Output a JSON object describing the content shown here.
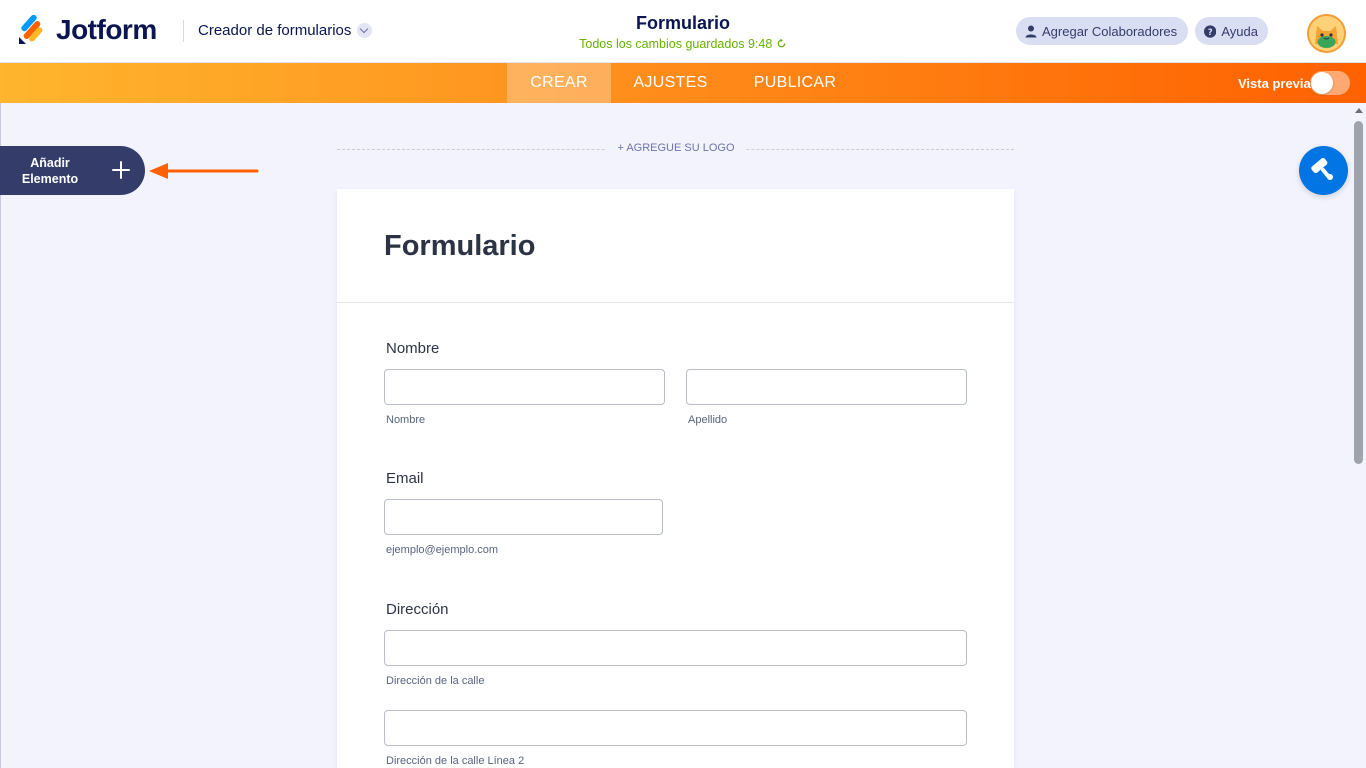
{
  "header": {
    "brand": "Jotform",
    "builder_label": "Creador de formularios",
    "form_title": "Formulario",
    "saved_status": "Todos los cambios guardados 9:48",
    "collaborators_label": "Agregar Colaboradores",
    "help_label": "Ayuda"
  },
  "nav": {
    "tabs": [
      {
        "label": "CREAR",
        "active": true
      },
      {
        "label": "AJUSTES",
        "active": false
      },
      {
        "label": "PUBLICAR",
        "active": false
      }
    ],
    "preview_label": "Vista previa",
    "preview_on": false,
    "accent": "#ff6100"
  },
  "sidebar": {
    "add_element_line1": "Añadir",
    "add_element_line2": "Elemento"
  },
  "form": {
    "add_logo_label": "+ AGREGUE SU LOGO",
    "title": "Formulario",
    "fields": [
      {
        "label": "Nombre",
        "sublabels": [
          "Nombre",
          "Apellido"
        ]
      },
      {
        "label": "Email",
        "sublabels": [
          "ejemplo@ejemplo.com"
        ]
      },
      {
        "label": "Dirección",
        "sublabels": [
          "Dirección de la calle",
          "Dirección de la calle Línea 2"
        ]
      }
    ]
  },
  "colors": {
    "brand_dark": "#0a1551",
    "saved_green": "#64b200",
    "fab_blue": "#0075e3",
    "sidebar_button": "#343c6a"
  }
}
